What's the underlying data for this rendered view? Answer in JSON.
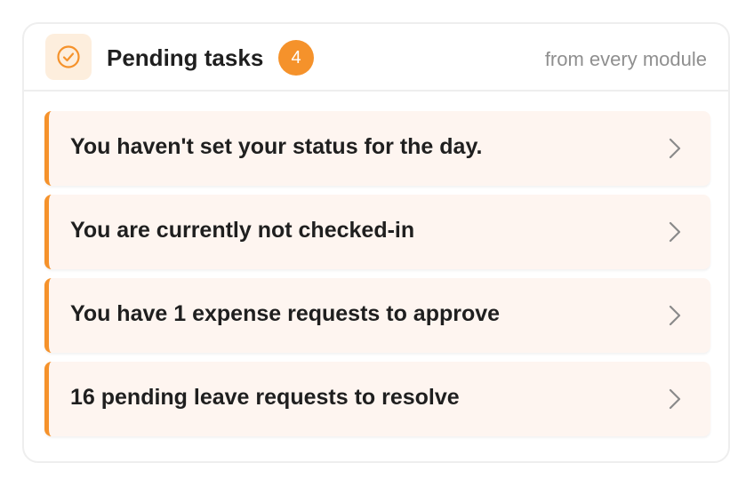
{
  "header": {
    "title": "Pending tasks",
    "count": "4",
    "subtitle": "from every module",
    "icon": "check-circle-icon"
  },
  "colors": {
    "accent": "#f5922b",
    "item_background": "#fef5f0",
    "icon_background": "#fdeedd"
  },
  "tasks": [
    {
      "label": "You haven't set your status for the day.",
      "icon": "chevron-right-icon"
    },
    {
      "label": "You are currently not checked-in",
      "icon": "chevron-right-icon"
    },
    {
      "label": "You have 1 expense requests to approve",
      "icon": "chevron-right-icon"
    },
    {
      "label": "16 pending leave requests to resolve",
      "icon": "chevron-right-icon"
    }
  ]
}
